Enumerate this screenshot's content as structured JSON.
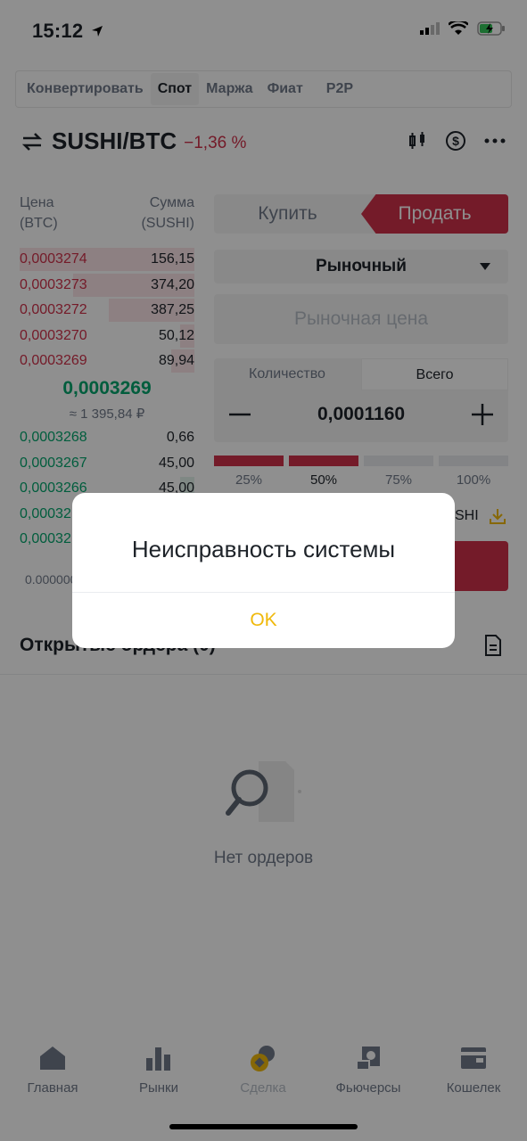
{
  "status": {
    "time": "15:12"
  },
  "tabs": [
    {
      "label": "Конвертировать"
    },
    {
      "label": "Спот",
      "active": true
    },
    {
      "label": "Маржа"
    },
    {
      "label": "Фиат"
    },
    {
      "label": "P2P"
    }
  ],
  "pair": {
    "name": "SUSHI/BTC",
    "change": "−1,36 %"
  },
  "orderbook": {
    "price_header_1": "Цена",
    "price_header_2": "(BTC)",
    "amount_header_1": "Сумма",
    "amount_header_2": "(SUSHI)",
    "asks": [
      {
        "price": "0,0003274",
        "amount": "156,15"
      },
      {
        "price": "0,0003273",
        "amount": "374,20"
      },
      {
        "price": "0,0003272",
        "amount": "387,25"
      },
      {
        "price": "0,0003270",
        "amount": "50,12"
      },
      {
        "price": "0,0003269",
        "amount": "89,94"
      }
    ],
    "last_price": "0,0003269",
    "last_price_fiat": "≈ 1 395,84 ₽",
    "bids": [
      {
        "price": "0,0003268",
        "amount": "0,66"
      },
      {
        "price": "0,0003267",
        "amount": "45,00"
      },
      {
        "price": "0,0003266",
        "amount": "45,00"
      },
      {
        "price": "0,00032",
        "amount": ""
      },
      {
        "price": "0,00032",
        "amount": ""
      }
    ],
    "precision": "0.000000"
  },
  "trade": {
    "buy_label": "Купить",
    "sell_label": "Продать",
    "order_type": "Рыночный",
    "price_placeholder": "Рыночная цена",
    "qty_tab": "Количество",
    "total_tab": "Всего",
    "quantity": "0,0001160",
    "percents": [
      "25%",
      "50%",
      "75%",
      "100%"
    ],
    "available_suffix": "SHI"
  },
  "orders": {
    "title": "Открытые ордера (0)",
    "empty": "Нет ордеров"
  },
  "dialog": {
    "message": "Неисправность системы",
    "ok": "OK"
  },
  "nav": [
    {
      "label": "Главная"
    },
    {
      "label": "Рынки"
    },
    {
      "label": "Сделка"
    },
    {
      "label": "Фьючерсы"
    },
    {
      "label": "Кошелек"
    }
  ],
  "colors": {
    "red": "#cf304a",
    "green": "#03a66d",
    "accent": "#f0b90b"
  }
}
